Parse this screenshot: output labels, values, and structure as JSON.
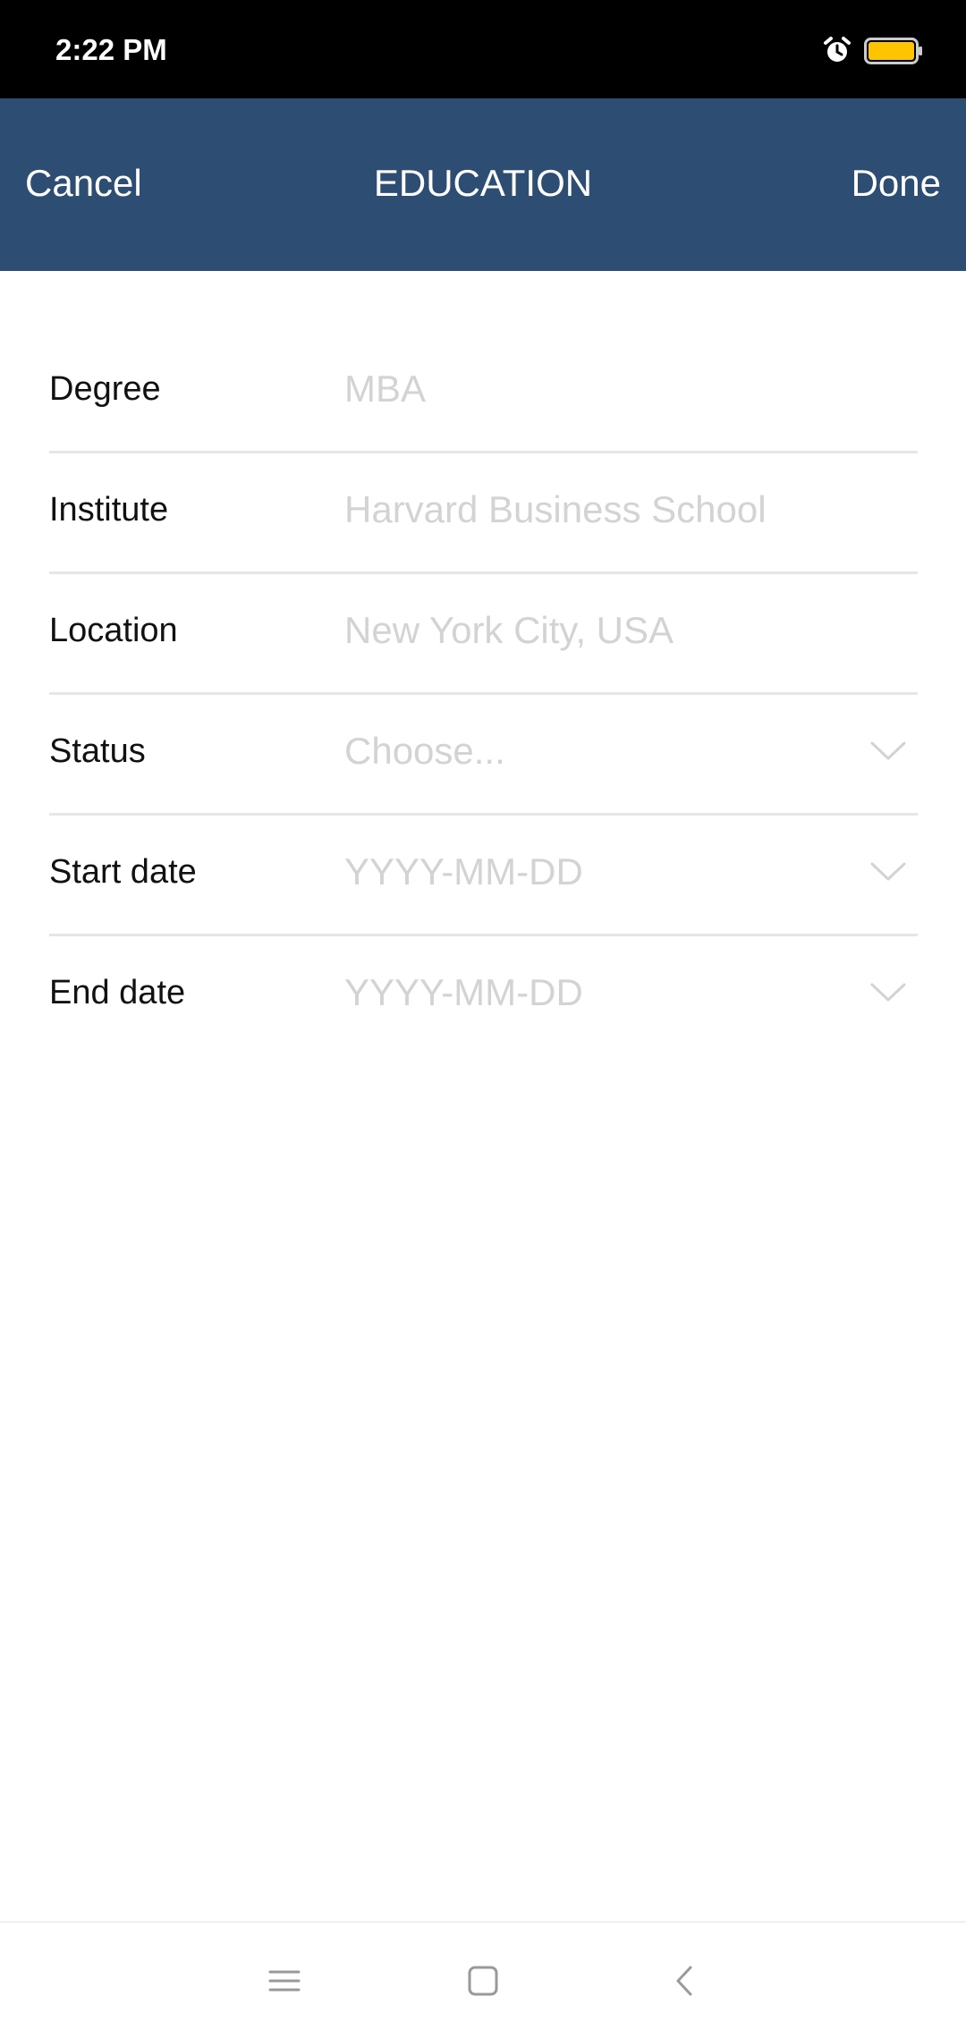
{
  "status_bar": {
    "time": "2:22 PM",
    "alarm_icon": "alarm-clock-icon",
    "battery_icon": "battery-icon",
    "battery_color": "#ffc400"
  },
  "header": {
    "cancel_label": "Cancel",
    "title": "EDUCATION",
    "done_label": "Done",
    "background_color": "#2e4d72"
  },
  "form": {
    "degree": {
      "label": "Degree",
      "value": "",
      "placeholder": "MBA"
    },
    "institute": {
      "label": "Institute",
      "value": "",
      "placeholder": "Harvard Business School"
    },
    "location": {
      "label": "Location",
      "value": "",
      "placeholder": "New York City, USA"
    },
    "status": {
      "label": "Status",
      "placeholder": "Choose...",
      "icon": "chevron-down-icon"
    },
    "start_date": {
      "label": "Start date",
      "placeholder": "YYYY-MM-DD",
      "icon": "chevron-down-icon"
    },
    "end_date": {
      "label": "End date",
      "placeholder": "YYYY-MM-DD",
      "icon": "chevron-down-icon"
    }
  },
  "nav_bar": {
    "menu_icon": "menu-icon",
    "home_icon": "home-square-icon",
    "back_icon": "back-arrow-icon"
  }
}
